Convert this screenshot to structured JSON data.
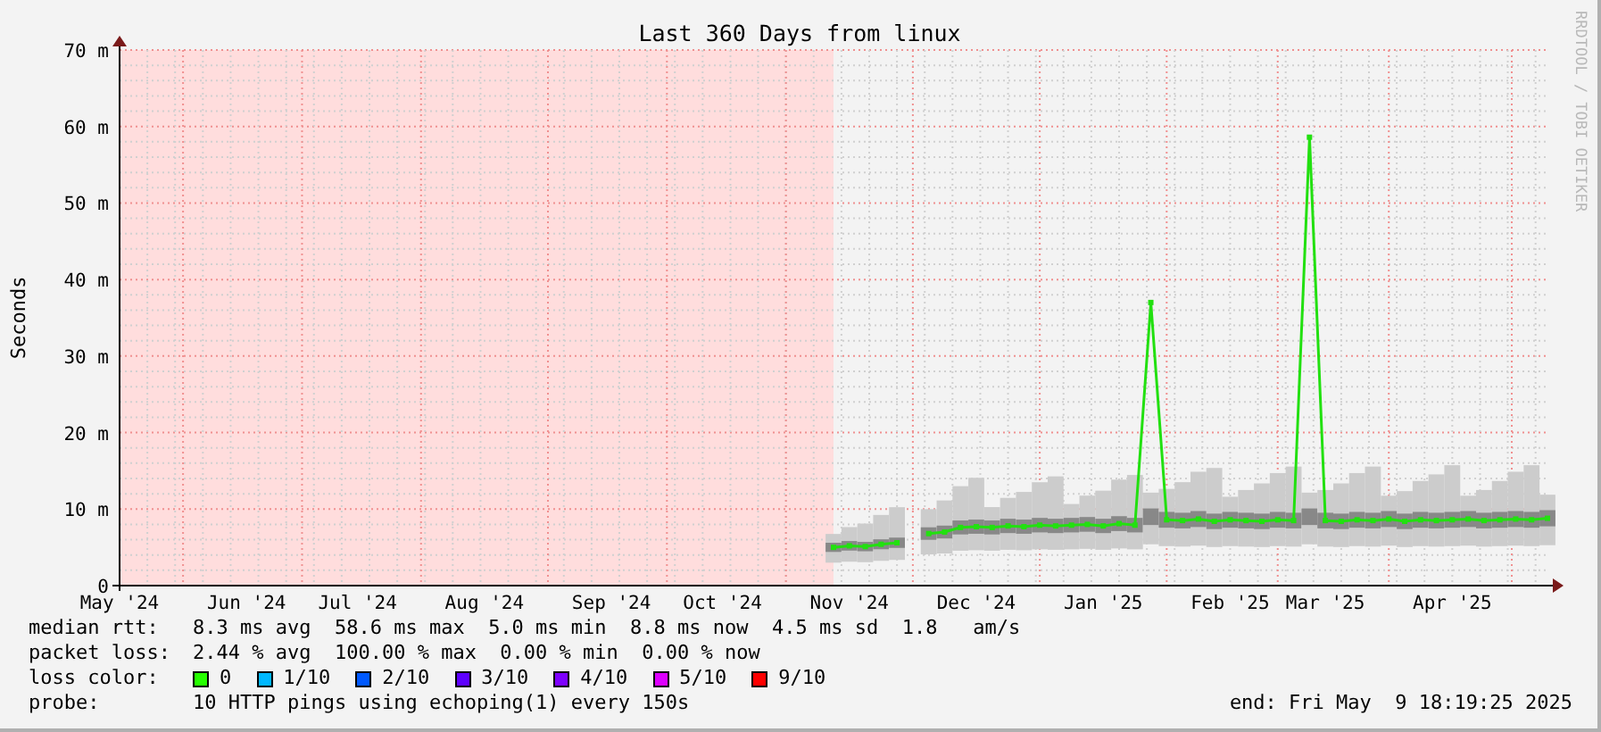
{
  "graph": {
    "side_label": "RRDTOOL / TOBI OETIKER",
    "chart_data": {
      "type": "line",
      "grid": true,
      "title": "Last 360 Days from linux",
      "ylabel": "Seconds",
      "ylim": [
        0,
        70
      ],
      "yticks": [
        {
          "value": 0,
          "label": "0"
        },
        {
          "value": 10,
          "label": "10 m"
        },
        {
          "value": 20,
          "label": "20 m"
        },
        {
          "value": 30,
          "label": "30 m"
        },
        {
          "value": 40,
          "label": "40 m"
        },
        {
          "value": 50,
          "label": "50 m"
        },
        {
          "value": 60,
          "label": "60 m"
        },
        {
          "value": 70,
          "label": "70 m"
        }
      ],
      "categories": [
        "May '24",
        null,
        null,
        null,
        null,
        null,
        null,
        null,
        "Jun '24",
        null,
        null,
        null,
        null,
        null,
        null,
        "Jul '24",
        null,
        null,
        null,
        null,
        null,
        null,
        null,
        "Aug '24",
        null,
        null,
        null,
        null,
        null,
        null,
        null,
        "Sep '24",
        null,
        null,
        null,
        null,
        null,
        null,
        "Oct '24",
        null,
        null,
        null,
        null,
        null,
        null,
        null,
        "Nov '24",
        null,
        null,
        null,
        null,
        null,
        null,
        null,
        "Dec '24",
        null,
        null,
        null,
        null,
        null,
        null,
        null,
        "Jan '25",
        null,
        null,
        null,
        null,
        null,
        null,
        null,
        "Feb '25",
        null,
        null,
        null,
        null,
        null,
        "Mar '25",
        null,
        null,
        null,
        null,
        null,
        null,
        null,
        "Apr '25",
        null,
        null,
        null,
        null,
        null,
        null
      ],
      "series": [
        {
          "marker": "square",
          "color": "#22e010",
          "values": [
            null,
            null,
            null,
            null,
            null,
            null,
            null,
            null,
            null,
            null,
            null,
            null,
            null,
            null,
            null,
            null,
            null,
            null,
            null,
            null,
            null,
            null,
            null,
            null,
            null,
            null,
            null,
            null,
            null,
            null,
            null,
            null,
            null,
            null,
            null,
            null,
            null,
            null,
            null,
            null,
            null,
            null,
            null,
            null,
            null,
            5.0,
            5.2,
            5.1,
            5.4,
            5.6,
            null,
            6.8,
            7.0,
            7.6,
            7.7,
            7.6,
            7.8,
            7.7,
            7.9,
            7.8,
            7.9,
            8.0,
            7.8,
            8.1,
            7.9,
            37.0,
            8.6,
            8.5,
            8.7,
            8.4,
            8.6,
            8.5,
            8.4,
            8.6,
            8.5,
            58.6,
            8.5,
            8.4,
            8.6,
            8.5,
            8.7,
            8.4,
            8.6,
            8.5,
            8.6,
            8.7,
            8.5,
            8.6,
            8.7,
            8.6,
            8.8
          ]
        }
      ]
    }
  },
  "legend": {
    "median_rtt": {
      "label": "median rtt:",
      "text": "8.3 ms avg  58.6 ms max  5.0 ms min  8.8 ms now  4.5 ms sd  1.8   am/s"
    },
    "packet_loss": {
      "label": "packet loss:",
      "text": "2.44 % avg  100.00 % max  0.00 % min  0.00 % now"
    },
    "loss_color": {
      "label": "loss color:",
      "items": [
        {
          "label": "0",
          "color": "#26ff00"
        },
        {
          "label": "1/10",
          "color": "#00b8ff"
        },
        {
          "label": "2/10",
          "color": "#0059ff"
        },
        {
          "label": "3/10",
          "color": "#5e00ff"
        },
        {
          "label": "4/10",
          "color": "#7e00ff"
        },
        {
          "label": "5/10",
          "color": "#dd00ff"
        },
        {
          "label": "9/10",
          "color": "#ff0000"
        }
      ]
    },
    "probe": {
      "label": "probe:",
      "text": "10 HTTP pings using echoping(1) every 150s"
    },
    "end": "end: Fri May  9 18:19:25 2025"
  }
}
